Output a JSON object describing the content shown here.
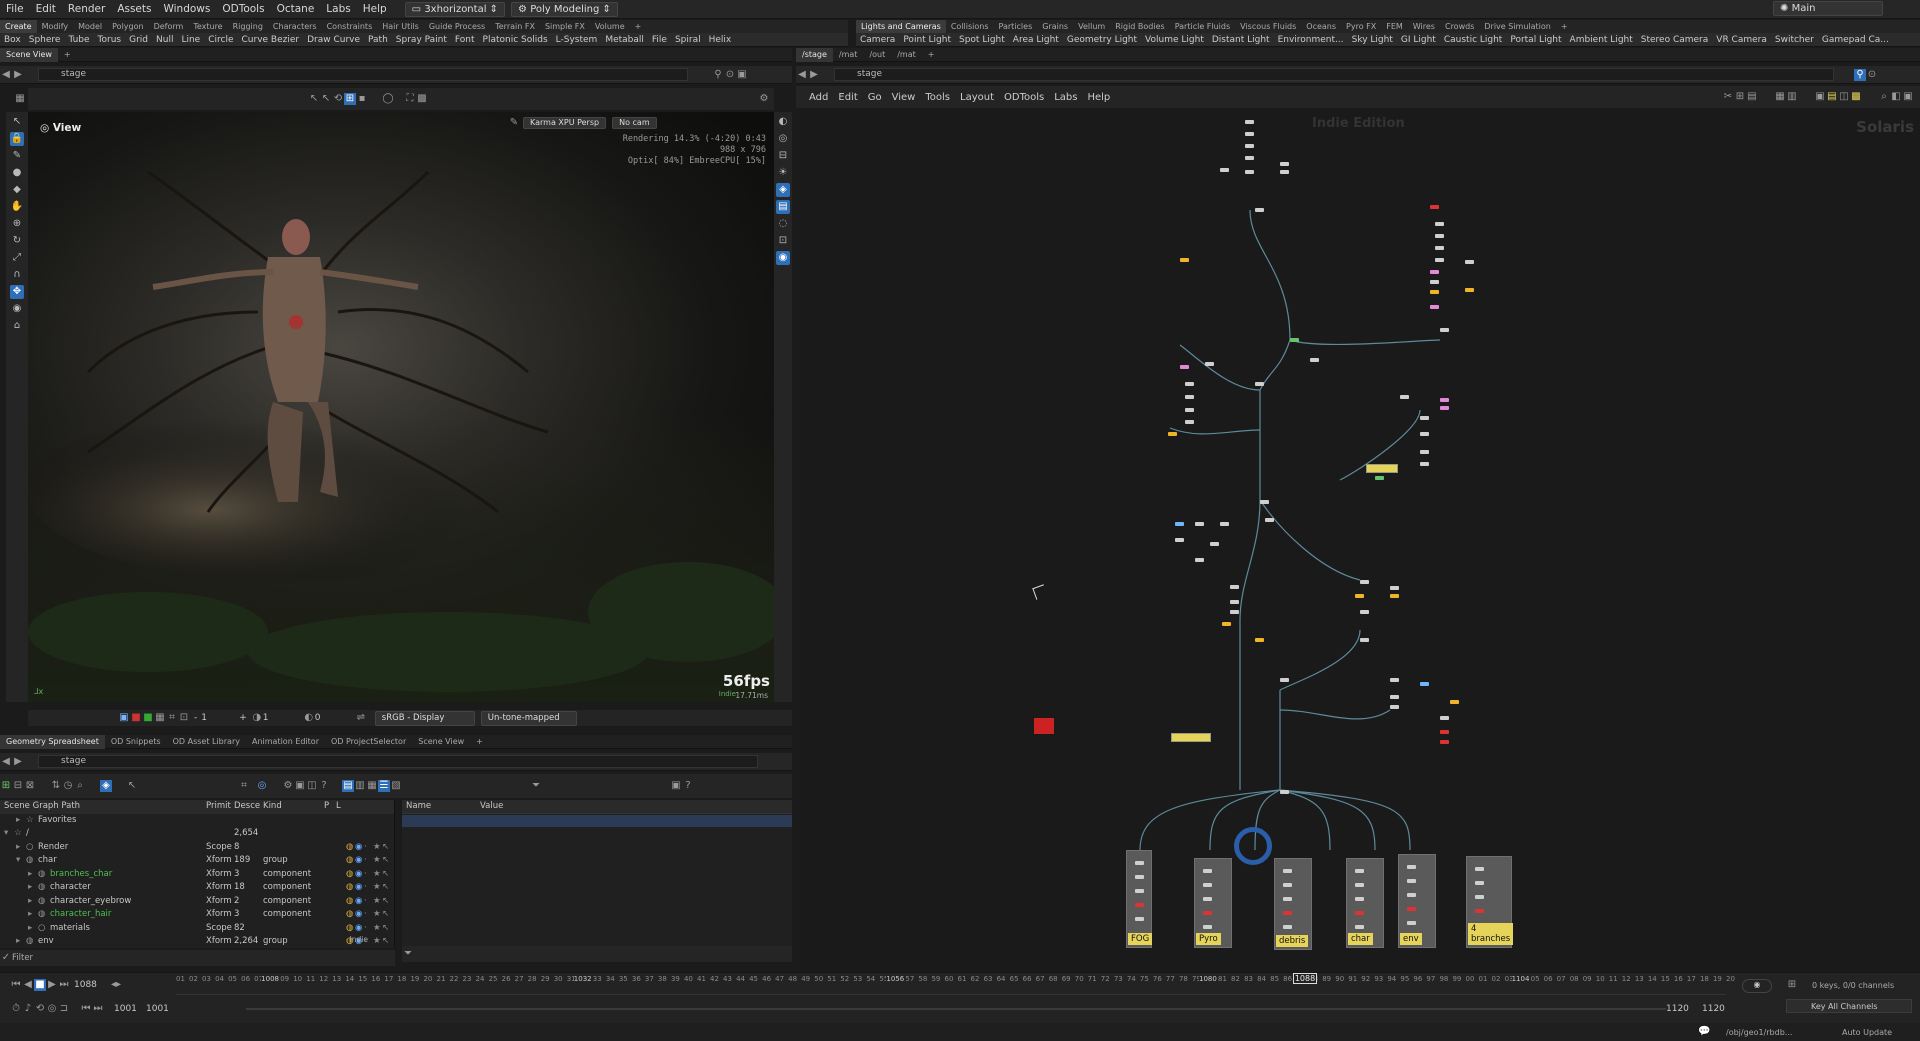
{
  "menu": {
    "items": [
      "File",
      "Edit",
      "Render",
      "Assets",
      "Windows",
      "ODTools",
      "Octane",
      "Labs",
      "Help"
    ],
    "desktop": "3xhorizontal",
    "layout": "Poly Modeling",
    "right_title": "Main"
  },
  "shelf_left": {
    "tabs": [
      "Create",
      "Modify",
      "Model",
      "Polygon",
      "Deform",
      "Texture",
      "Rigging",
      "Characters",
      "Constraints",
      "Hair Utils",
      "Guide Process",
      "Terrain FX",
      "Simple FX",
      "Volume"
    ],
    "tools": [
      "Box",
      "Sphere",
      "Tube",
      "Torus",
      "Grid",
      "Null",
      "Line",
      "Circle",
      "Curve Bezier",
      "Draw Curve",
      "Path",
      "Spray Paint",
      "Font",
      "Platonic Solids",
      "L-System",
      "Metaball",
      "File",
      "Spiral",
      "Helix"
    ]
  },
  "shelf_right": {
    "tabs": [
      "Lights and Cameras",
      "Collisions",
      "Particles",
      "Grains",
      "Vellum",
      "Rigid Bodies",
      "Particle Fluids",
      "Viscous Fluids",
      "Oceans",
      "Pyro FX",
      "FEM",
      "Wires",
      "Crowds",
      "Drive Simulation"
    ],
    "tools": [
      "Camera",
      "Point Light",
      "Spot Light",
      "Area Light",
      "Geometry Light",
      "Volume Light",
      "Distant Light",
      "Environment...",
      "Sky Light",
      "GI Light",
      "Caustic Light",
      "Portal Light",
      "Ambient Light",
      "Stereo Camera",
      "VR Camera",
      "Switcher",
      "Gamepad Ca..."
    ]
  },
  "scene_view": {
    "tab": "Scene View",
    "path": "stage",
    "title": "View",
    "renderer": "Karma XPU Persp",
    "camera": "No cam",
    "stats": [
      "Rendering  14.3%  (-4:20)  0:43",
      "988 x 796",
      "Optix[ 84%] EmbreeCPU[ 15%]"
    ],
    "fps": "56fps",
    "frame_ms": "17.71ms",
    "indie": "Indie",
    "bottom": {
      "val1": "1",
      "val2": "1",
      "val3": "0",
      "display": "sRGB - Display",
      "tonemap": "Un-tone-mapped"
    }
  },
  "lower_tabs": [
    "Geometry Spreadsheet",
    "OD Snippets",
    "OD Asset Library",
    "Animation Editor",
    "OD ProjectSelector",
    "Scene View"
  ],
  "scene_graph": {
    "path": "stage",
    "headers": [
      "Scene Graph Path",
      "Primit",
      "Desce",
      "Kind",
      "P",
      "L"
    ],
    "rows": [
      {
        "name": "Favorites",
        "type": "",
        "desc": "",
        "kind": "",
        "indent": 1,
        "color": "#c8c8c8"
      },
      {
        "name": "/",
        "type": "",
        "desc": "2,654",
        "kind": "",
        "indent": 0,
        "color": "#c8c8c8"
      },
      {
        "name": "Render",
        "type": "Scope",
        "desc": "8",
        "kind": "",
        "indent": 1,
        "color": "#c8c8c8"
      },
      {
        "name": "char",
        "type": "Xform",
        "desc": "189",
        "kind": "group",
        "indent": 1,
        "color": "#c8c8c8"
      },
      {
        "name": "branches_char",
        "type": "Xform",
        "desc": "3",
        "kind": "component",
        "indent": 2,
        "color": "#4fbf4f"
      },
      {
        "name": "character",
        "type": "Xform",
        "desc": "18",
        "kind": "component",
        "indent": 2,
        "color": "#c8c8c8"
      },
      {
        "name": "character_eyebrow",
        "type": "Xform",
        "desc": "2",
        "kind": "component",
        "indent": 2,
        "color": "#c8c8c8"
      },
      {
        "name": "character_hair",
        "type": "Xform",
        "desc": "3",
        "kind": "component",
        "indent": 2,
        "color": "#4fbf4f"
      },
      {
        "name": "materials",
        "type": "Scope",
        "desc": "82",
        "kind": "",
        "indent": 2,
        "color": "#c8c8c8"
      },
      {
        "name": "env",
        "type": "Xform",
        "desc": "2,264",
        "kind": "group",
        "indent": 1,
        "color": "#c8c8c8"
      }
    ],
    "filter": "Filter",
    "indie": "Indie"
  },
  "properties": {
    "headers": [
      "Name",
      "Value"
    ]
  },
  "network": {
    "tabs": [
      "/stage",
      "/mat",
      "/out",
      "/mat"
    ],
    "path": "stage",
    "menu": [
      "Add",
      "Edit",
      "Go",
      "View",
      "Tools",
      "Layout",
      "ODTools",
      "Labs",
      "Help"
    ],
    "watermark": "Indie Edition",
    "context": "Solaris",
    "boxes": [
      "FOG",
      "Pyro",
      "debris",
      "char",
      "env",
      "4 branches"
    ]
  },
  "timeline": {
    "frame": "1088",
    "start1": "1001",
    "start2": "1001",
    "end1": "1120",
    "end2": "1120",
    "ticks": [
      "1008",
      "1032",
      "1056",
      "1080",
      "1104"
    ],
    "current": "1088",
    "keys": "0 keys, 0/0 channels",
    "key_all": "Key All Channels",
    "status_path": "/obj/geo1/rbdb...",
    "auto": "Auto Update"
  },
  "colors": {
    "accent": "#2e6fb8",
    "node_bg": "#1a1a1a",
    "box_label": "#e6d35a"
  }
}
